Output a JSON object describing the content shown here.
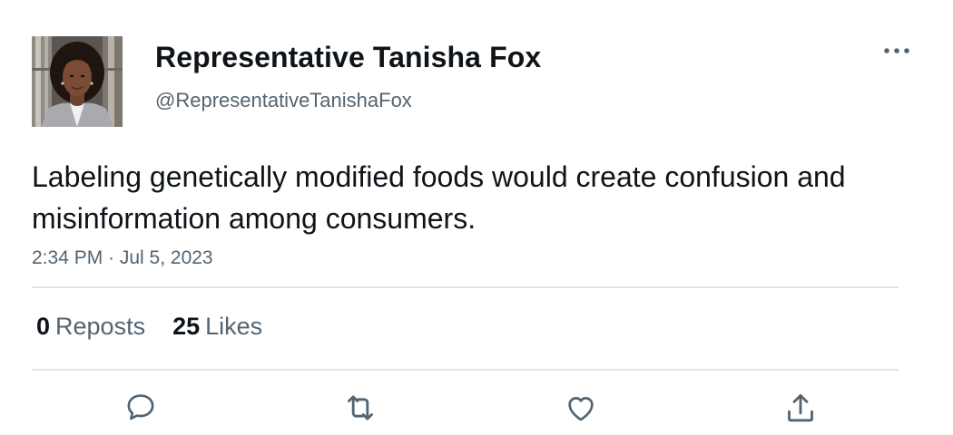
{
  "author": {
    "display_name": "Representative Tanisha Fox",
    "handle": "@RepresentativeTanishaFox",
    "avatar_icon": "profile-photo"
  },
  "post": {
    "text": "Labeling genetically modified foods would create confusion and misinformation among consumers.",
    "timestamp": "2:34 PM · Jul 5, 2023"
  },
  "stats": {
    "reposts_count": "0",
    "reposts_label": "Reposts",
    "likes_count": "25",
    "likes_label": "Likes"
  },
  "actions": [
    {
      "name": "reply",
      "icon": "speech-bubble-icon"
    },
    {
      "name": "repost",
      "icon": "repost-arrows-icon"
    },
    {
      "name": "like",
      "icon": "heart-icon"
    },
    {
      "name": "share",
      "icon": "share-upload-icon"
    }
  ],
  "colors": {
    "text_primary": "#0f1419",
    "text_secondary": "#536471",
    "divider": "#e1e5e8",
    "icon": "#536471"
  }
}
